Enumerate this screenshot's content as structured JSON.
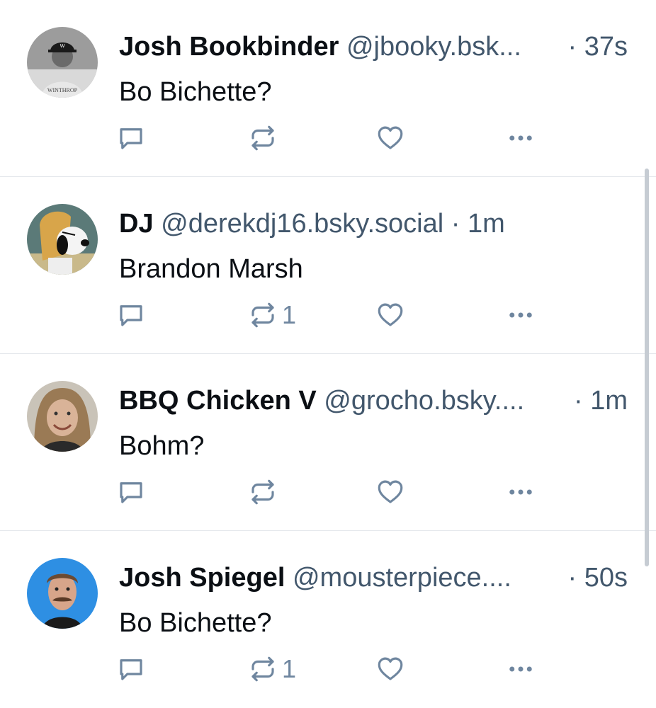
{
  "colors": {
    "text": "#0b0f14",
    "muted": "#42576c",
    "icon": "#6f869f",
    "divider": "#e3e7eb",
    "scrollbar": "#c6ccd3"
  },
  "posts": [
    {
      "name": "Josh Bookbinder",
      "handle": "@jbooky.bsk...",
      "time": "· 37s",
      "text": "Bo Bichette?",
      "repost_count": "",
      "avatar_icon": "user-avatar-photo-baseball-cap"
    },
    {
      "name": "DJ",
      "handle": "@derekdj16.bsky.social",
      "time": "· 1m",
      "text": "Brandon Marsh",
      "repost_count": "1",
      "avatar_icon": "user-avatar-cartoon-dog"
    },
    {
      "name": "BBQ Chicken V",
      "handle": "@grocho.bsky....",
      "time": "· 1m",
      "text": "Bohm?",
      "repost_count": "",
      "avatar_icon": "user-avatar-photo-person"
    },
    {
      "name": "Josh Spiegel",
      "handle": "@mousterpiece....",
      "time": "· 50s",
      "text": "Bo Bichette?",
      "repost_count": "1",
      "avatar_icon": "user-avatar-photo-mustache"
    }
  ]
}
